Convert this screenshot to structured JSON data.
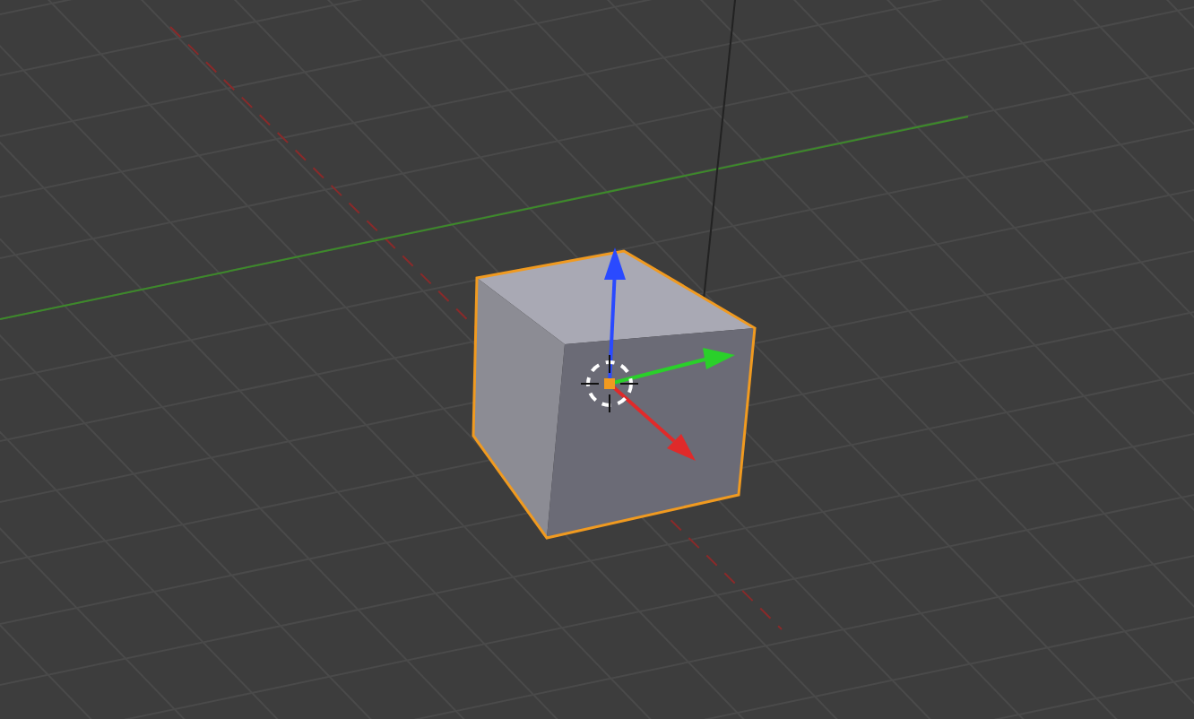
{
  "viewport": {
    "objects": [
      {
        "kind": "cube",
        "selected": true
      }
    ]
  }
}
